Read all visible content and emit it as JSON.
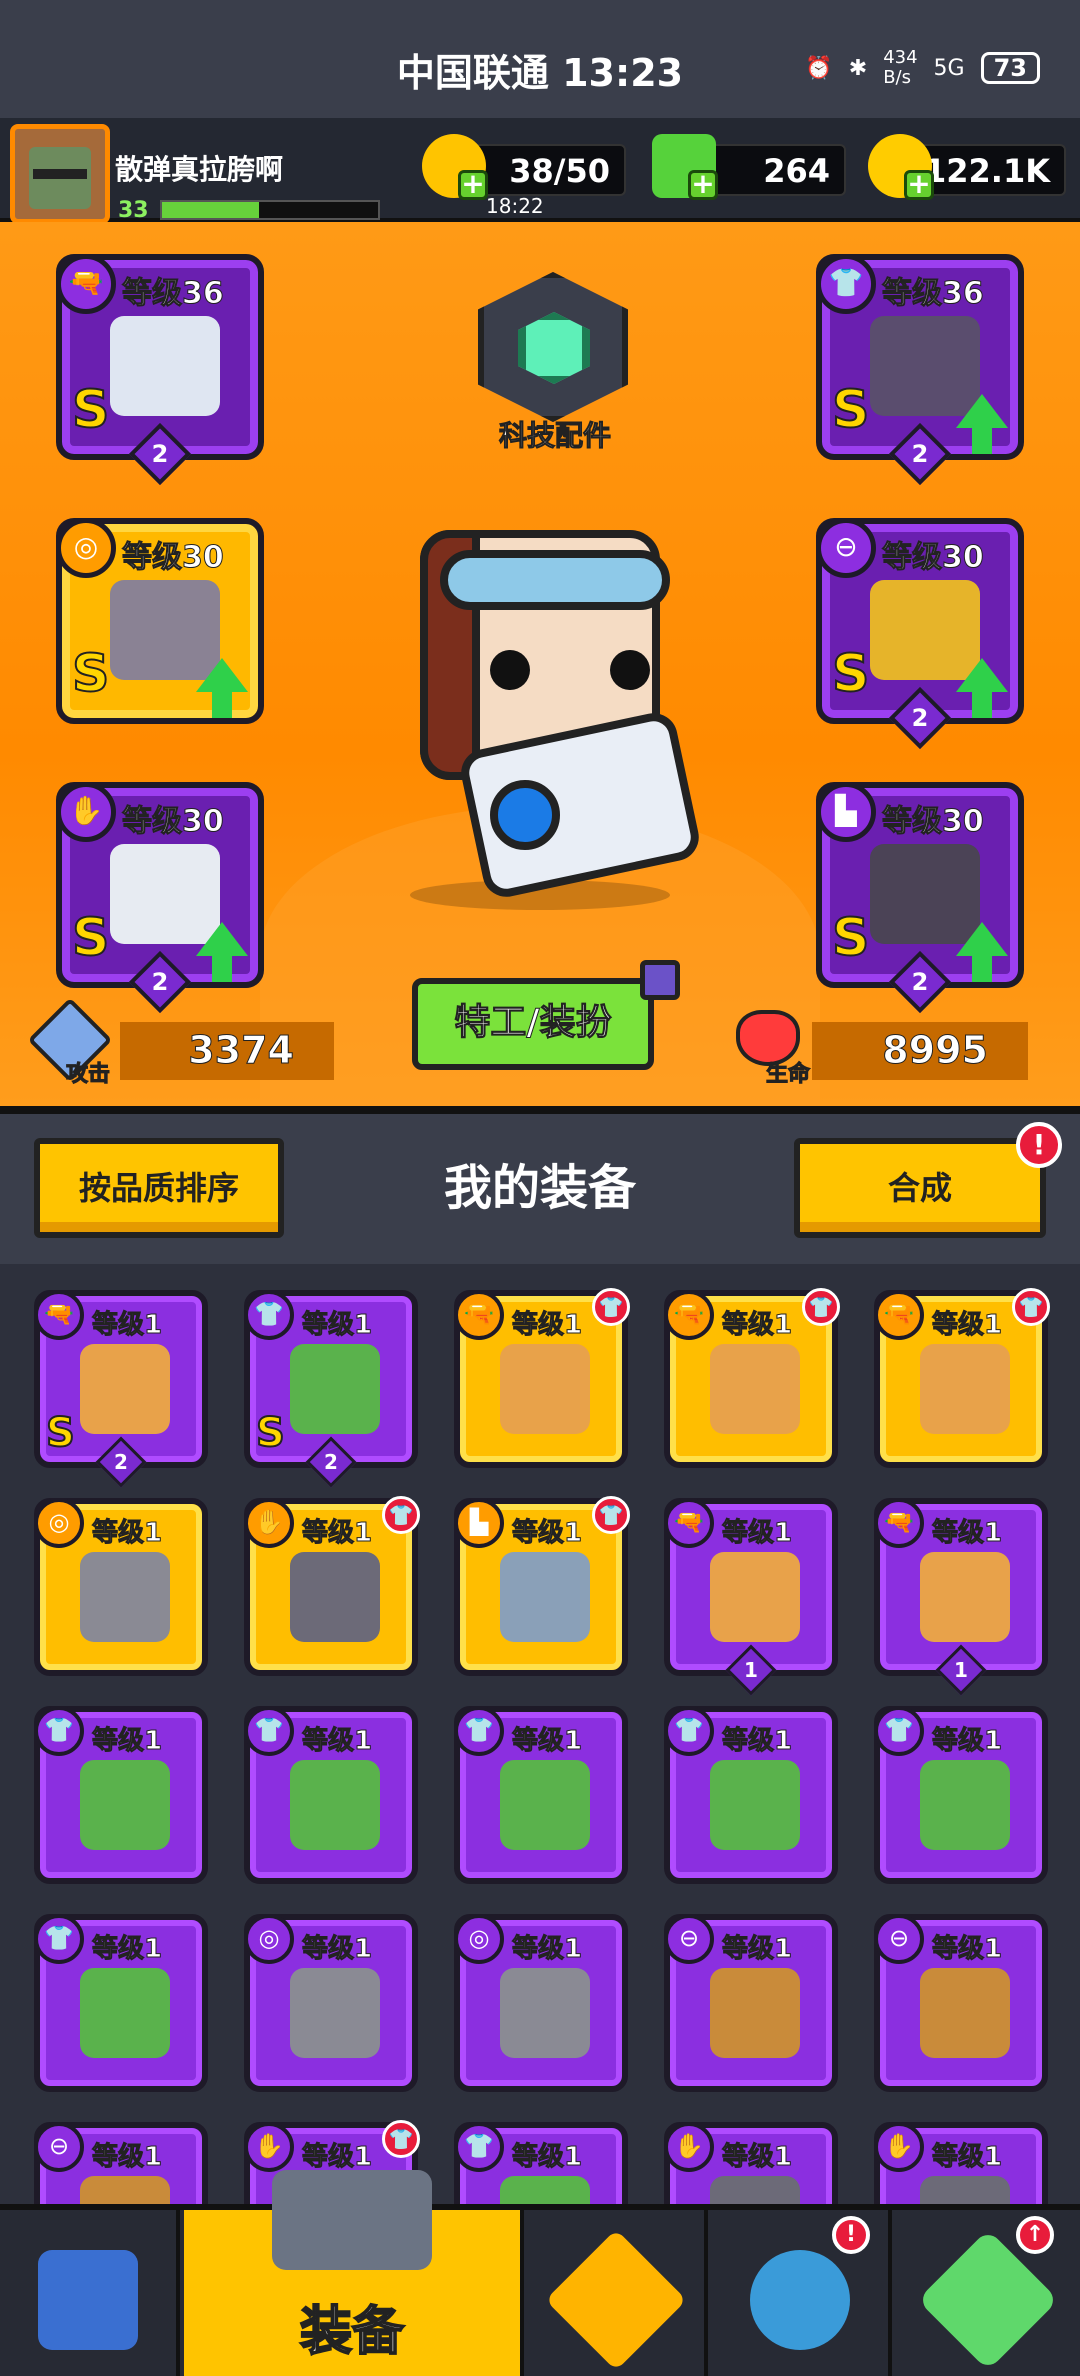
{
  "status": {
    "carrier_time": "中国联通 13:23",
    "net_speed": "434\nB/s",
    "signal": "5G",
    "battery": "73"
  },
  "player": {
    "name": "散弹真拉胯啊",
    "level": "33",
    "xp_progress": 0.45
  },
  "resources": {
    "energy": "38/50",
    "energy_timer": "18:22",
    "gems": "264",
    "gold": "122.1K"
  },
  "equipped": {
    "weapon": {
      "level_text": "等级36",
      "grade": "S",
      "stars": "2",
      "icon": "gun-icon",
      "gold": false,
      "upgrade": false
    },
    "armor": {
      "level_text": "等级36",
      "grade": "S",
      "stars": "2",
      "icon": "armor-icon",
      "gold": false,
      "upgrade": true
    },
    "necklace": {
      "level_text": "等级30",
      "grade": "S",
      "icon": "necklace-icon",
      "gold": true,
      "upgrade": true
    },
    "belt": {
      "level_text": "等级30",
      "grade": "S",
      "stars": "2",
      "icon": "belt-icon",
      "gold": false,
      "upgrade": true
    },
    "gloves": {
      "level_text": "等级30",
      "grade": "S",
      "stars": "2",
      "icon": "gloves-icon",
      "gold": false,
      "upgrade": true
    },
    "boots": {
      "level_text": "等级30",
      "grade": "S",
      "stars": "2",
      "icon": "boots-icon",
      "gold": false,
      "upgrade": true
    }
  },
  "tech": {
    "label": "科技配件"
  },
  "stats": {
    "attack_label": "攻击",
    "attack": "3374",
    "hp_label": "生命",
    "hp": "8995"
  },
  "agent_button": "特工/装扮",
  "panel": {
    "sort_button": "按品质排序",
    "title": "我的装备",
    "merge_button": "合成",
    "merge_badge": "!"
  },
  "items": [
    {
      "lv": "等级1",
      "kind": "gun",
      "gold": false,
      "grade": "S",
      "stars": "2",
      "red": false
    },
    {
      "lv": "等级1",
      "kind": "armor",
      "gold": false,
      "grade": "S",
      "stars": "2",
      "red": false
    },
    {
      "lv": "等级1",
      "kind": "gun",
      "gold": true,
      "grade": "",
      "stars": "",
      "red": true
    },
    {
      "lv": "等级1",
      "kind": "gun",
      "gold": true,
      "grade": "",
      "stars": "",
      "red": true
    },
    {
      "lv": "等级1",
      "kind": "gun",
      "gold": true,
      "grade": "",
      "stars": "",
      "red": true
    },
    {
      "lv": "等级1",
      "kind": "necklace",
      "gold": true,
      "grade": "",
      "stars": "",
      "red": false
    },
    {
      "lv": "等级1",
      "kind": "gloves",
      "gold": true,
      "grade": "",
      "stars": "",
      "red": true
    },
    {
      "lv": "等级1",
      "kind": "boots",
      "gold": true,
      "grade": "",
      "stars": "",
      "red": true
    },
    {
      "lv": "等级1",
      "kind": "gun",
      "gold": false,
      "grade": "",
      "stars": "1",
      "red": false
    },
    {
      "lv": "等级1",
      "kind": "gun",
      "gold": false,
      "grade": "",
      "stars": "1",
      "red": false
    },
    {
      "lv": "等级1",
      "kind": "armor",
      "gold": false,
      "grade": "",
      "stars": "",
      "red": false
    },
    {
      "lv": "等级1",
      "kind": "armor",
      "gold": false,
      "grade": "",
      "stars": "",
      "red": false
    },
    {
      "lv": "等级1",
      "kind": "armor",
      "gold": false,
      "grade": "",
      "stars": "",
      "red": false
    },
    {
      "lv": "等级1",
      "kind": "armor",
      "gold": false,
      "grade": "",
      "stars": "",
      "red": false
    },
    {
      "lv": "等级1",
      "kind": "armor",
      "gold": false,
      "grade": "",
      "stars": "",
      "red": false
    },
    {
      "lv": "等级1",
      "kind": "armor",
      "gold": false,
      "grade": "",
      "stars": "",
      "red": false
    },
    {
      "lv": "等级1",
      "kind": "necklace",
      "gold": false,
      "grade": "",
      "stars": "",
      "red": false
    },
    {
      "lv": "等级1",
      "kind": "necklace",
      "gold": false,
      "grade": "",
      "stars": "",
      "red": false
    },
    {
      "lv": "等级1",
      "kind": "belt",
      "gold": false,
      "grade": "",
      "stars": "",
      "red": false
    },
    {
      "lv": "等级1",
      "kind": "belt",
      "gold": false,
      "grade": "",
      "stars": "",
      "red": false
    },
    {
      "lv": "等级1",
      "kind": "belt",
      "gold": false,
      "grade": "",
      "stars": "",
      "red": false
    },
    {
      "lv": "等级1",
      "kind": "gloves",
      "gold": false,
      "grade": "",
      "stars": "",
      "red": true
    },
    {
      "lv": "等级1",
      "kind": "armor",
      "gold": false,
      "grade": "",
      "stars": "",
      "red": false
    },
    {
      "lv": "等级1",
      "kind": "gloves",
      "gold": false,
      "grade": "",
      "stars": "",
      "red": false
    },
    {
      "lv": "等级1",
      "kind": "gloves",
      "gold": false,
      "grade": "",
      "stars": "",
      "red": false
    }
  ],
  "nav": {
    "equip_label": "装备",
    "badge": "!"
  },
  "colors": {
    "purple": "#8b2fe0",
    "gold": "#ffbe00",
    "orange": "#ff8a00",
    "green": "#7be23b"
  }
}
